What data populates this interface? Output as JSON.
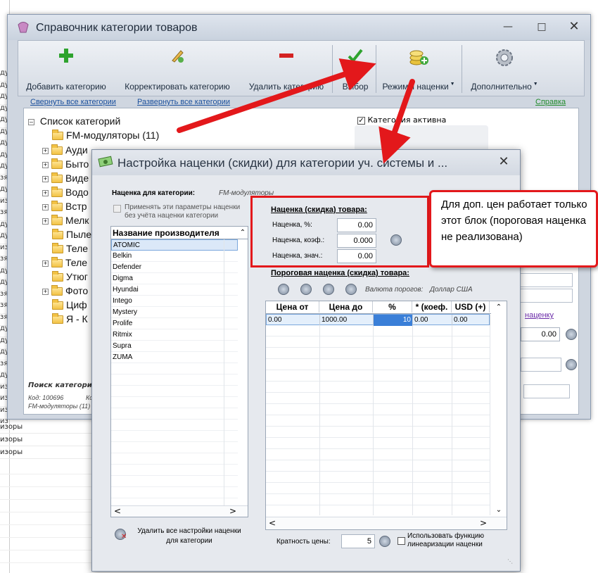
{
  "bg_left_rows": [
    "ду",
    "ду",
    "ду",
    "ду",
    "ду",
    "ду",
    "ду",
    "ду",
    "ду",
    "зя",
    "ду",
    "из",
    "зя",
    "ду",
    "ду",
    "из",
    "зя",
    "ду",
    "ду",
    "зя",
    "зя",
    "зя",
    "ду",
    "ду",
    "ду",
    "зя",
    "ду",
    "из",
    "из",
    "из",
    "из"
  ],
  "bg_bottom_rows": [
    "изоры",
    "изоры",
    "изоры"
  ],
  "main_window": {
    "title": "Справочник категории товаров",
    "toolbar": {
      "add_category": "Добавить категорию",
      "edit_category": "Корректировать категорию",
      "delete_category": "Удалить категорию",
      "select": "Выбор",
      "markup_modes": "Режимы наценки",
      "more": "Дополнительно"
    },
    "links": {
      "collapse_all": "Свернуть все категории",
      "expand_all": "Развернуть все категории",
      "help": "Справка"
    },
    "tree": {
      "root": "Список категорий",
      "items": [
        "FM-модуляторы (11)",
        "Ауди",
        "Быто",
        "Виде",
        "Водо",
        "Встр",
        "Мелк",
        "Пыле",
        "Теле",
        "Теле",
        "Утюг",
        "Фото",
        "Циф",
        "Я - К"
      ]
    },
    "category_active": "Категория активна",
    "search": {
      "label": "Поиск категори",
      "code": "Код: 100696",
      "code2": "Код",
      "name": "FM-модуляторы (11)"
    },
    "right_link": "наценку",
    "right_value": "0.00"
  },
  "dialog": {
    "title": "Настройка наценки (скидки) для категории уч. системы и ...",
    "markup_for_category_label": "Наценка для категории:",
    "markup_for_category_value": "FM-модуляторы",
    "apply_params": "Применять эти параметры наценки",
    "apply_params2": "без учёта наценки категории",
    "manufacturers_header": "Название производителя",
    "manufacturers": [
      "ATOMIC",
      "Belkin",
      "Defender",
      "Digma",
      "Hyundai",
      "Intego",
      "Mystery",
      "Prolife",
      "Ritmix",
      "Supra",
      "ZUMA"
    ],
    "markup_section_title": "Наценка (скидка) товара:",
    "markup_percent_label": "Наценка, %:",
    "markup_percent_value": "0.00",
    "markup_coef_label": "Наценка, коэф.:",
    "markup_coef_value": "0.000",
    "markup_value_label": "Наценка, знач.:",
    "markup_value_value": "0.00",
    "threshold_title": "Пороговая наценка (скидка) товара:",
    "threshold_currency_label": "Валюта порогов:",
    "threshold_currency_value": "Доллар США",
    "threshold_columns": [
      "Цена от",
      "Цена до",
      "%",
      "* (коеф.",
      "USD (+)"
    ],
    "threshold_row": [
      "0.00",
      "1000.00",
      "10",
      "0.00",
      "0.00"
    ],
    "delete_settings": "Удалить все настройки наценки",
    "delete_settings2": "для категории",
    "price_multiple_label": "Кратность цены:",
    "price_multiple_value": "5",
    "linearization": "Использовать функцию",
    "linearization2": "линеаризации наценки"
  },
  "callout": {
    "text": "Для доп. цен работает только этот блок (пороговая наценка не реализована)"
  },
  "colors": {
    "annotation_red": "#e3181b",
    "link_blue": "#1a4f9c",
    "help_green": "#1f8a2a"
  }
}
